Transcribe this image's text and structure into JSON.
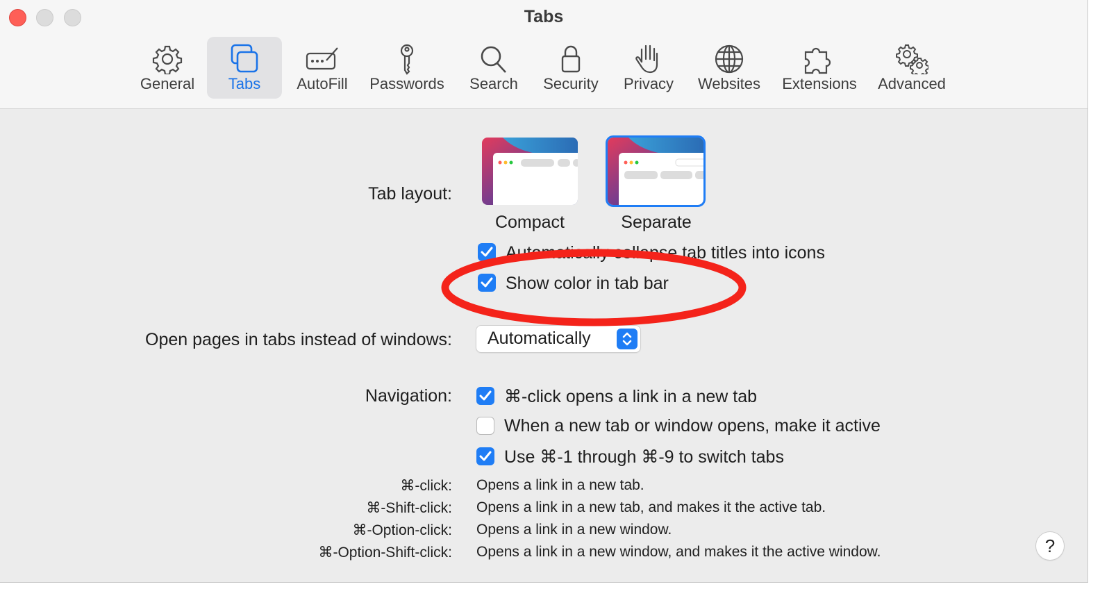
{
  "window": {
    "title": "Tabs"
  },
  "toolbar": {
    "items": [
      {
        "label": "General",
        "icon": "gear-icon"
      },
      {
        "label": "Tabs",
        "icon": "tabs-icon",
        "selected": true
      },
      {
        "label": "AutoFill",
        "icon": "autofill-icon"
      },
      {
        "label": "Passwords",
        "icon": "key-icon"
      },
      {
        "label": "Search",
        "icon": "search-icon"
      },
      {
        "label": "Security",
        "icon": "lock-icon"
      },
      {
        "label": "Privacy",
        "icon": "hand-icon"
      },
      {
        "label": "Websites",
        "icon": "globe-icon"
      },
      {
        "label": "Extensions",
        "icon": "puzzle-icon"
      },
      {
        "label": "Advanced",
        "icon": "gears-icon"
      }
    ]
  },
  "tab_layout": {
    "label": "Tab layout:",
    "options": [
      {
        "label": "Compact",
        "selected": false
      },
      {
        "label": "Separate",
        "selected": true
      }
    ],
    "collapse_titles": {
      "label": "Automatically collapse tab titles into icons",
      "checked": true
    },
    "show_color": {
      "label": "Show color in tab bar",
      "checked": true
    }
  },
  "open_pages": {
    "label": "Open pages in tabs instead of windows:",
    "value": "Automatically"
  },
  "navigation": {
    "label": "Navigation:",
    "options": [
      {
        "label": "⌘-click opens a link in a new tab",
        "checked": true
      },
      {
        "label": "When a new tab or window opens, make it active",
        "checked": false
      },
      {
        "label": "Use ⌘-1 through ⌘-9 to switch tabs",
        "checked": true
      }
    ]
  },
  "shortcuts": [
    {
      "key": "⌘-click:",
      "desc": "Opens a link in a new tab."
    },
    {
      "key": "⌘-Shift-click:",
      "desc": "Opens a link in a new tab, and makes it the active tab."
    },
    {
      "key": "⌘-Option-click:",
      "desc": "Opens a link in a new window."
    },
    {
      "key": "⌘-Option-Shift-click:",
      "desc": "Opens a link in a new window, and makes it the active window."
    }
  ],
  "help": {
    "label": "?"
  },
  "colors": {
    "accent": "#1f7df5",
    "annotation": "#f4231a",
    "close": "#fe5f57"
  }
}
